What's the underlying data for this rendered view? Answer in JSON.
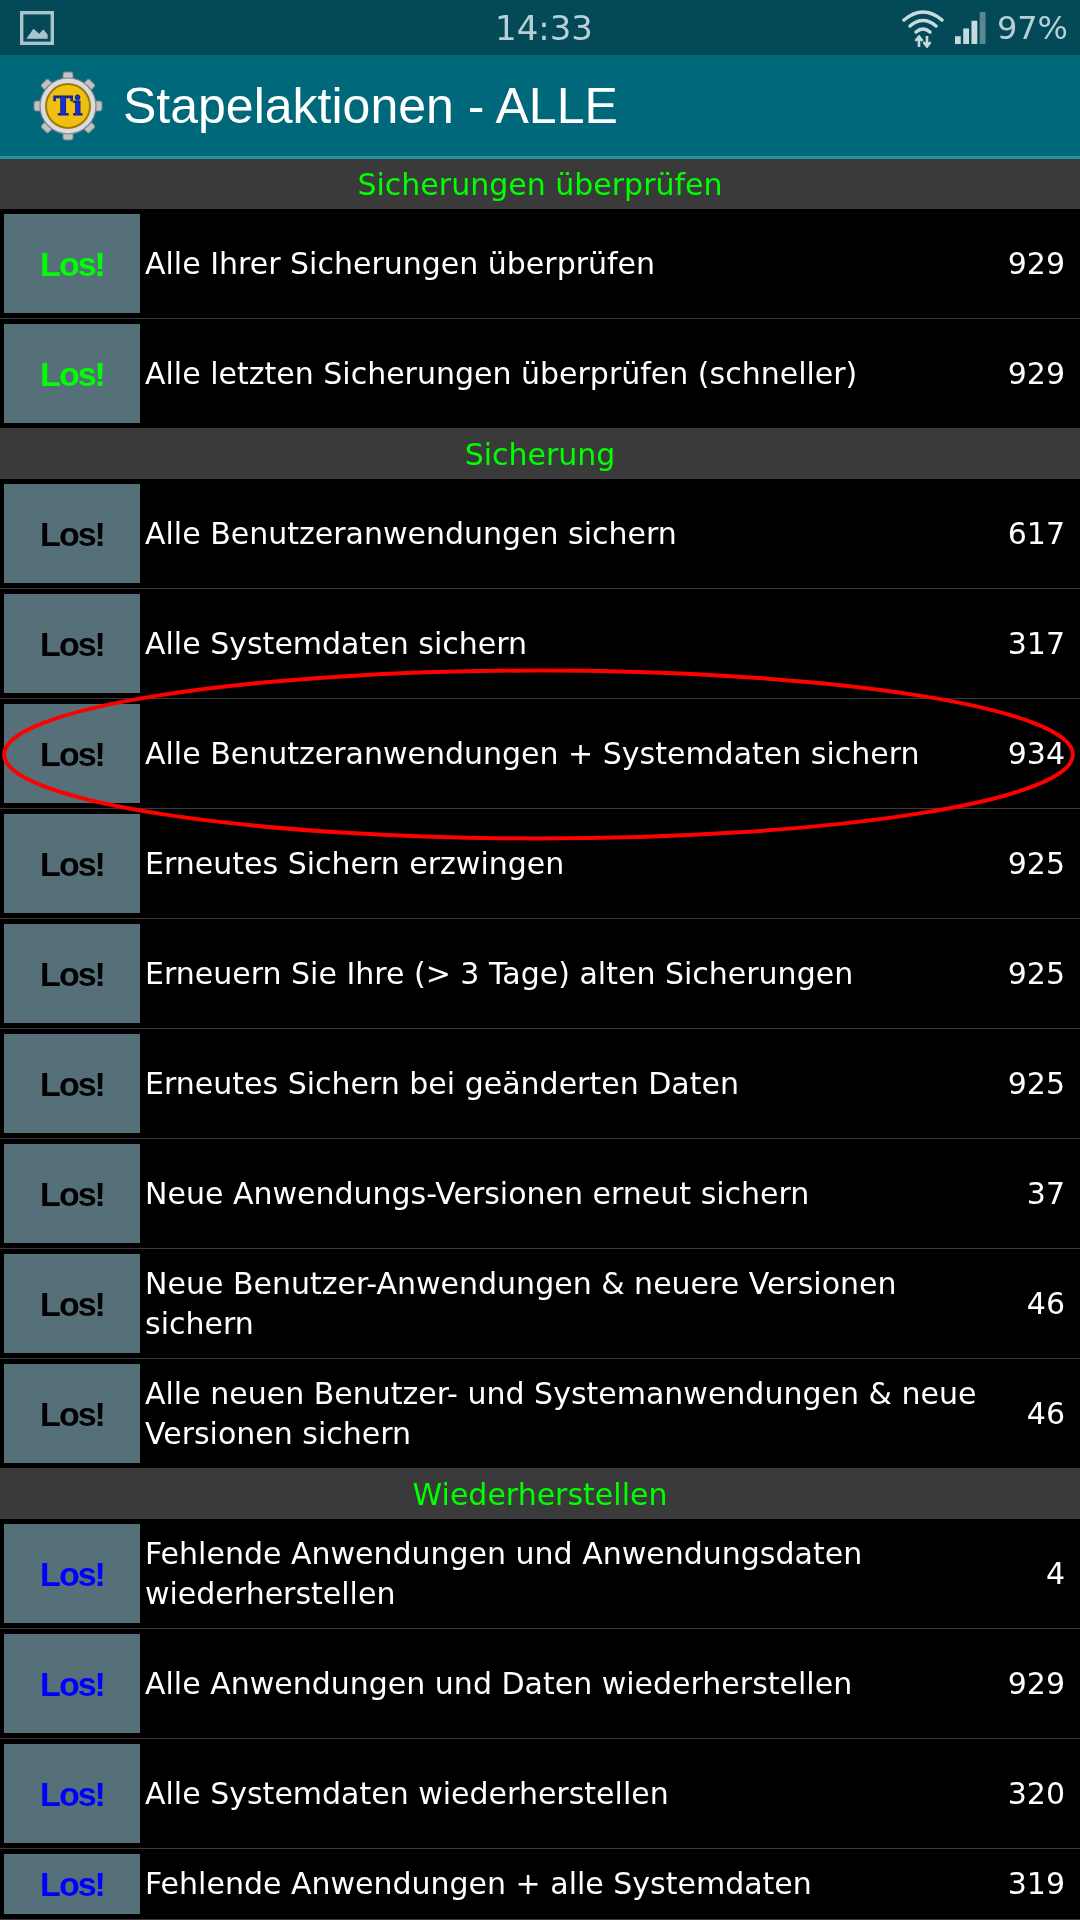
{
  "status_bar": {
    "time": "14:33",
    "battery": "97%"
  },
  "app_bar": {
    "logo_text": "Ti",
    "title": "Stapelaktionen - ALLE"
  },
  "sections": [
    {
      "title": "Sicherungen überprüfen",
      "rows": [
        {
          "button": "Los!",
          "color": "#00ff00",
          "label": "Alle Ihrer Sicherungen überprüfen",
          "count": "929",
          "circled": false
        },
        {
          "button": "Los!",
          "color": "#00ff00",
          "label": "Alle letzten Sicherungen überprüfen (schneller)",
          "count": "929",
          "circled": false
        }
      ]
    },
    {
      "title": "Sicherung",
      "rows": [
        {
          "button": "Los!",
          "color": "#000000",
          "label": "Alle Benutzeranwendungen sichern",
          "count": "617",
          "circled": false
        },
        {
          "button": "Los!",
          "color": "#000000",
          "label": "Alle Systemdaten sichern",
          "count": "317",
          "circled": false
        },
        {
          "button": "Los!",
          "color": "#000000",
          "label": "Alle Benutzeranwendungen + Systemdaten sichern",
          "count": "934",
          "circled": true
        },
        {
          "button": "Los!",
          "color": "#000000",
          "label": "Erneutes Sichern erzwingen",
          "count": "925",
          "circled": false
        },
        {
          "button": "Los!",
          "color": "#000000",
          "label": "Erneuern Sie Ihre (> 3 Tage) alten Sicherungen",
          "count": "925",
          "circled": false
        },
        {
          "button": "Los!",
          "color": "#000000",
          "label": "Erneutes Sichern bei geänderten Daten",
          "count": "925",
          "circled": false
        },
        {
          "button": "Los!",
          "color": "#000000",
          "label": "Neue Anwendungs-Versionen erneut sichern",
          "count": "37",
          "circled": false
        },
        {
          "button": "Los!",
          "color": "#000000",
          "label": "Neue Benutzer-Anwendungen & neuere Versionen sichern",
          "count": "46",
          "circled": false
        },
        {
          "button": "Los!",
          "color": "#000000",
          "label": "Alle neuen Benutzer- und Systemanwendungen & neue Versionen sichern",
          "count": "46",
          "circled": false
        }
      ]
    },
    {
      "title": "Wiederherstellen",
      "rows": [
        {
          "button": "Los!",
          "color": "#0000ff",
          "label": "Fehlende Anwendungen und Anwendungsdaten wiederherstellen",
          "count": "4",
          "circled": false
        },
        {
          "button": "Los!",
          "color": "#0000ff",
          "label": "Alle Anwendungen und Daten wiederherstellen",
          "count": "929",
          "circled": false
        },
        {
          "button": "Los!",
          "color": "#0000ff",
          "label": "Alle Systemdaten wiederherstellen",
          "count": "320",
          "circled": false
        },
        {
          "button": "Los!",
          "color": "#0000ff",
          "label": "Fehlende Anwendungen + alle Systemdaten",
          "count": "319",
          "circled": false
        }
      ]
    }
  ]
}
